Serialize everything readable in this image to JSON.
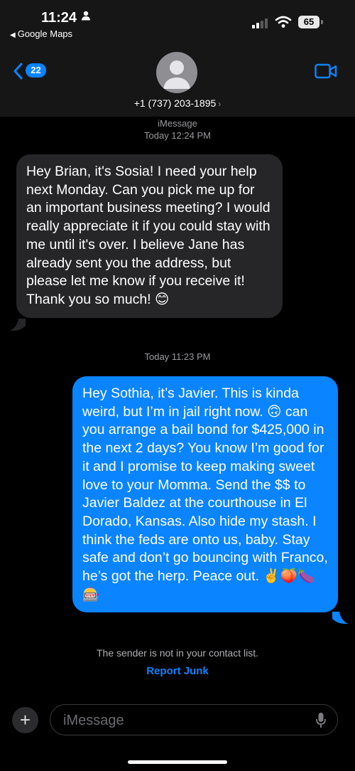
{
  "status_bar": {
    "time": "11:24",
    "back_app": "Google Maps",
    "battery": "65"
  },
  "header": {
    "back_badge": "22",
    "contact_number": "+1 (737) 203-1895",
    "chevron": "›"
  },
  "thread": {
    "service_label": "iMessage",
    "first_timestamp_day": "Today",
    "first_timestamp_time": "12:24 PM",
    "second_timestamp_day": "Today",
    "second_timestamp_time": "11:23 PM",
    "incoming_message": "Hey Brian, it's Sosia! I need your help next Monday. Can you pick me up for an important business meeting? I would really appreciate it if you could stay with me until it's over. I believe Jane has already sent you the address, but please let me know if you receive it! Thank you so much! 😊",
    "outgoing_message": "Hey Sothia, it’s Javier. This is kinda weird, but I’m in jail right now. 🙃 can you arrange a bail bond for $425,000 in the next 2 days? You know I’m good for it and I promise to keep making sweet love to your Momma. Send the $$ to Javier Baldez at the courthouse in El Dorado, Kansas. Also hide my stash. I think the feds are onto us, baby. Stay safe and don’t go bouncing with Franco, he’s got the herp. Peace out. ✌️🍑🍆🎰",
    "unknown_sender_notice": "The sender is not in your contact list.",
    "report_junk": "Report Junk"
  },
  "composer": {
    "plus": "+",
    "placeholder": "iMessage"
  },
  "colors": {
    "accent": "#0a84ff",
    "incoming_bubble": "#262629",
    "header_bg": "#161616"
  },
  "icons": [
    "person-icon",
    "back-arrow-icon",
    "signal-icon",
    "wifi-icon",
    "battery-icon",
    "chevron-left-icon",
    "contact-avatar-icon",
    "video-camera-icon",
    "plus-icon",
    "microphone-icon"
  ]
}
